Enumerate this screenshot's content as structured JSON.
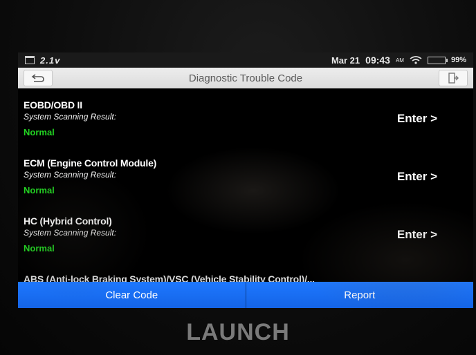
{
  "statusbar": {
    "signal_text": "2.1v",
    "date": "Mar 21",
    "time": "09:43",
    "ampm": "AM",
    "battery_pct": "99%",
    "battery_level": 0.99
  },
  "titlebar": {
    "title": "Diagnostic Trouble Code"
  },
  "systems": [
    {
      "name": "EOBD/OBD II",
      "result_label": "System Scanning Result:",
      "status": "Normal",
      "action": "Enter >"
    },
    {
      "name": "ECM (Engine Control Module)",
      "result_label": "System Scanning Result:",
      "status": "Normal",
      "action": "Enter >"
    },
    {
      "name": "HC (Hybrid Control)",
      "result_label": "System Scanning Result:",
      "status": "Normal",
      "action": "Enter >"
    },
    {
      "name": "ABS (Anti-lock Braking System)/VSC (Vehicle Stability Control)/..."
    }
  ],
  "buttons": {
    "clear_code": "Clear Code",
    "report": "Report"
  },
  "brand": "LAUNCH",
  "colors": {
    "accent_blue": "#1e78ff",
    "status_green": "#22d422"
  }
}
